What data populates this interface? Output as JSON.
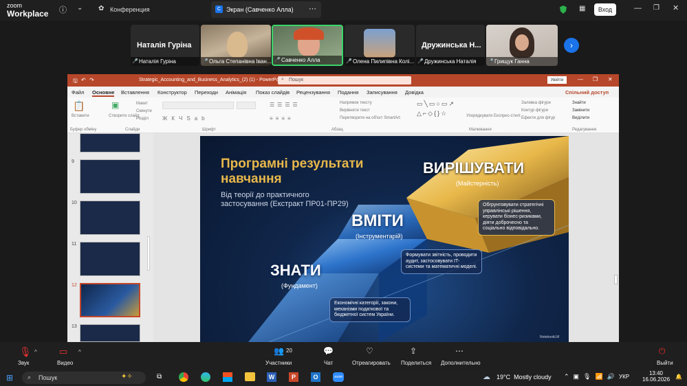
{
  "zoom": {
    "logo_top": "zoom",
    "logo_bottom": "Workplace",
    "meeting_label": "Конференция",
    "screen_tab": "Экран (Савченко Алла)",
    "signin": "Вход"
  },
  "participants": {
    "big_left": "Наталія Гуріна",
    "big_right": "Дружинська Н...",
    "tiles": [
      {
        "name": "Наталія Гуріна"
      },
      {
        "name": "Ольга Степанівна Іван..."
      },
      {
        "name": "Савченко Алла"
      },
      {
        "name": "Олена Пилипівна Колі..."
      },
      {
        "name": "Дружинська Наталія"
      },
      {
        "name": "Грищук Ганна"
      }
    ]
  },
  "ppt": {
    "file_title": "Strategic_Accounting_and_Business_Analytics_(2) (1) - PowerPoint",
    "search_placeholder": "Пошук",
    "signin": "Увійти",
    "share": "Спільний доступ",
    "menu": [
      "Файл",
      "Основне",
      "Вставлення",
      "Конструктор",
      "Переходи",
      "Анімація",
      "Показ слайдів",
      "Рецензування",
      "Подання",
      "Записування",
      "Довідка"
    ],
    "ribbon": {
      "clipboard": "Буфер обміну",
      "paste": "Вставити",
      "slides": "Слайди",
      "new_slide": "Створити слайд",
      "layout": "Макет",
      "reset": "Скинути",
      "section": "Розділ",
      "font": "Шрифт",
      "paragraph": "Абзац",
      "text_direction": "Напрямок тексту",
      "align_text": "Вирівняти текст",
      "smartart": "Перетворити на об'єкт SmartArt",
      "drawing": "Малювання",
      "arrange": "Упорядкувати",
      "quick_styles": "Експрес-стилі",
      "shape_fill": "Заливка фігури",
      "shape_outline": "Контур фігури",
      "shape_effects": "Ефекти для фігур",
      "find": "Знайти",
      "replace": "Замінити",
      "select": "Виділити",
      "editing": "Редагування"
    },
    "slide_numbers": [
      "9",
      "10",
      "11",
      "12",
      "13"
    ]
  },
  "slide": {
    "title_line1": "Програмні результати",
    "title_line2": "навчання",
    "subtitle_line1": "Від теорії до практичного",
    "subtitle_line2": "застосування (Екстракт ПР01-ПР29)",
    "level3_title": "ВИРІШУВАТИ",
    "level3_sub": "(Майстерність)",
    "level3_text": "Обгрунтовувати стратегічні управлінські рішення, керувати бізнес-ризиками, діяти доброчесно та соціально відповідально.",
    "level2_title": "ВМІТИ",
    "level2_sub": "(Інструментарій)",
    "level2_text": "Формувати звітність, проводити аудит, застосовувати IT-системи та математичні моделі.",
    "level1_title": "ЗНАТИ",
    "level1_sub": "(Фундамент)",
    "level1_text": "Економічні категорії, закони, механізми податкової та бюджетної систем України.",
    "watermark": "NotebookLM"
  },
  "controls": {
    "audio": "Звук",
    "video": "Видео",
    "participants": "Участники",
    "participants_count": "20",
    "chat": "Чат",
    "react": "Отреагировать",
    "share": "Поделиться",
    "more": "Дополнительно",
    "leave": "Выйти"
  },
  "taskbar": {
    "search": "Пошук",
    "weather": "19°C  Mostly cloudy",
    "lang": "УКР",
    "time": "13:40",
    "date": "16.06.2026"
  },
  "colors": {
    "ppt_accent": "#b7472a",
    "zoom_bg": "#1f1f1f",
    "gold": "#e8b84a",
    "leave_red": "#e02828"
  }
}
